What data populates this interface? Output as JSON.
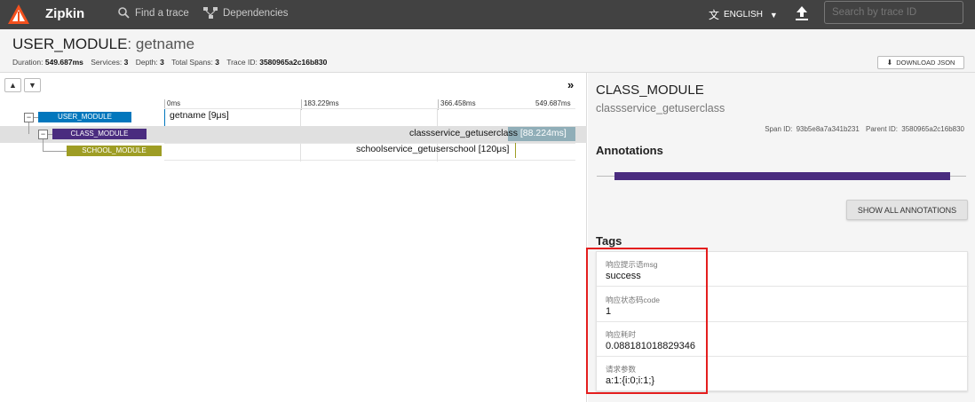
{
  "topbar": {
    "brand": "Zipkin",
    "nav": [
      {
        "label": "Find a trace",
        "icon": "search-icon"
      },
      {
        "label": "Dependencies",
        "icon": "dependencies-icon"
      }
    ],
    "language": "ENGLISH",
    "search_placeholder": "Search by trace ID"
  },
  "trace": {
    "service": "USER_MODULE",
    "span_name": ": getname",
    "meta": {
      "duration_label": "Duration:",
      "duration": "549.687ms",
      "services_label": "Services:",
      "services": "3",
      "depth_label": "Depth:",
      "depth": "3",
      "total_spans_label": "Total Spans:",
      "total_spans": "3",
      "trace_id_label": "Trace ID:",
      "trace_id": "3580965a2c16b830"
    },
    "download_label": "DOWNLOAD JSON"
  },
  "timeline": {
    "ticks": [
      "0ms",
      "183.229ms",
      "366.458ms",
      "549.687ms"
    ],
    "spans": [
      {
        "service": "USER_MODULE",
        "label": "getname [9μs]",
        "color": "#0277bd"
      },
      {
        "service": "CLASS_MODULE",
        "label": "classservice_getuserclass",
        "duration": "[88.224ms]",
        "color": "#4a2c7f"
      },
      {
        "service": "SCHOOL_MODULE",
        "label": "schoolservice_getuserschool [120μs]",
        "color": "#9e9d24"
      }
    ]
  },
  "detail": {
    "service": "CLASS_MODULE",
    "span_name": "classservice_getuserclass",
    "span_id_label": "Span ID:",
    "span_id": "93b5e8a7a341b231",
    "parent_id_label": "Parent ID:",
    "parent_id": "3580965a2c16b830",
    "annotations_heading": "Annotations",
    "show_all_label": "SHOW ALL ANNOTATIONS",
    "annotation_color": "#4a2c7f",
    "tags_heading": "Tags",
    "tags": [
      {
        "key": "响应提示语msg",
        "value": "success"
      },
      {
        "key": "响应状态码code",
        "value": "1"
      },
      {
        "key": "响应耗时",
        "value": "0.088181018829346"
      },
      {
        "key": "请求参数",
        "value": "a:1:{i:0;i:1;}"
      }
    ]
  }
}
